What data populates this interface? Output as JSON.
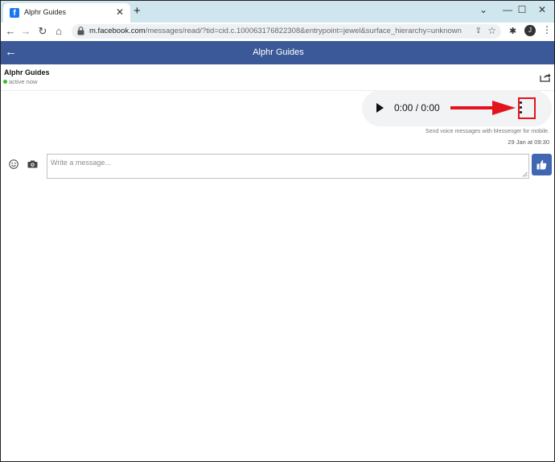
{
  "browser": {
    "tab": {
      "favicon": "f",
      "title": "Alphr Guides",
      "close_glyph": "✕"
    },
    "new_tab_glyph": "+",
    "window_controls": {
      "chevron": "⌄",
      "minimize": "—",
      "maximize": "☐",
      "close": "✕"
    },
    "nav": {
      "back": "←",
      "forward": "→",
      "reload": "↻",
      "home": "⌂"
    },
    "url": {
      "host": "m.facebook.com",
      "path": "/messages/read/?tid=cid.c.100063176822308&entrypoint=jewel&surface_hierarchy=unknown"
    },
    "profile_initial": "J",
    "menu_glyph": "⋮",
    "star_glyph": "☆",
    "extensions_glyph": "✱",
    "share_glyph": "⇪"
  },
  "header": {
    "back_glyph": "←",
    "title": "Alphr Guides"
  },
  "thread": {
    "contact_name": "Alphr Guides",
    "status": "active now",
    "status_color": "#42b72a",
    "audio": {
      "time": "0:00 / 0:00"
    },
    "caption": "Send voice messages with Messenger for mobile.",
    "timestamp": "29 Jan at 09:30"
  },
  "composer": {
    "placeholder": "Write a message..."
  },
  "colors": {
    "facebook_blue": "#3b5998",
    "highlight_red": "#e3141b",
    "tab_strip": "#cfe6ef"
  }
}
